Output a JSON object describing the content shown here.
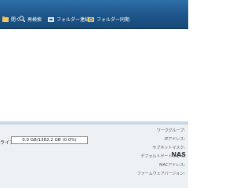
{
  "toolbar": {
    "items": [
      {
        "label": "開く",
        "icon": "open-icon"
      },
      {
        "label": "再検索",
        "icon": "search-icon"
      },
      {
        "label": "フォルダー連結",
        "icon": "folder-link-icon"
      },
      {
        "label": "フォルダー同期",
        "icon": "folder-sync-icon"
      }
    ]
  },
  "drive": {
    "label": "ライブ",
    "usage": "0.0 GB/1382.2 GB (0.0%)"
  },
  "details": {
    "title": "NAS",
    "fields": [
      "ワークグループ:",
      "IPアドレス:",
      "サブネットマスク:",
      "デフォルトゲートウェイ:",
      "MACアドレス:",
      "ファームウェアバージョン:"
    ]
  },
  "colors": {
    "toolbar": "#1d5589",
    "info_bg": "#eef1f4"
  }
}
